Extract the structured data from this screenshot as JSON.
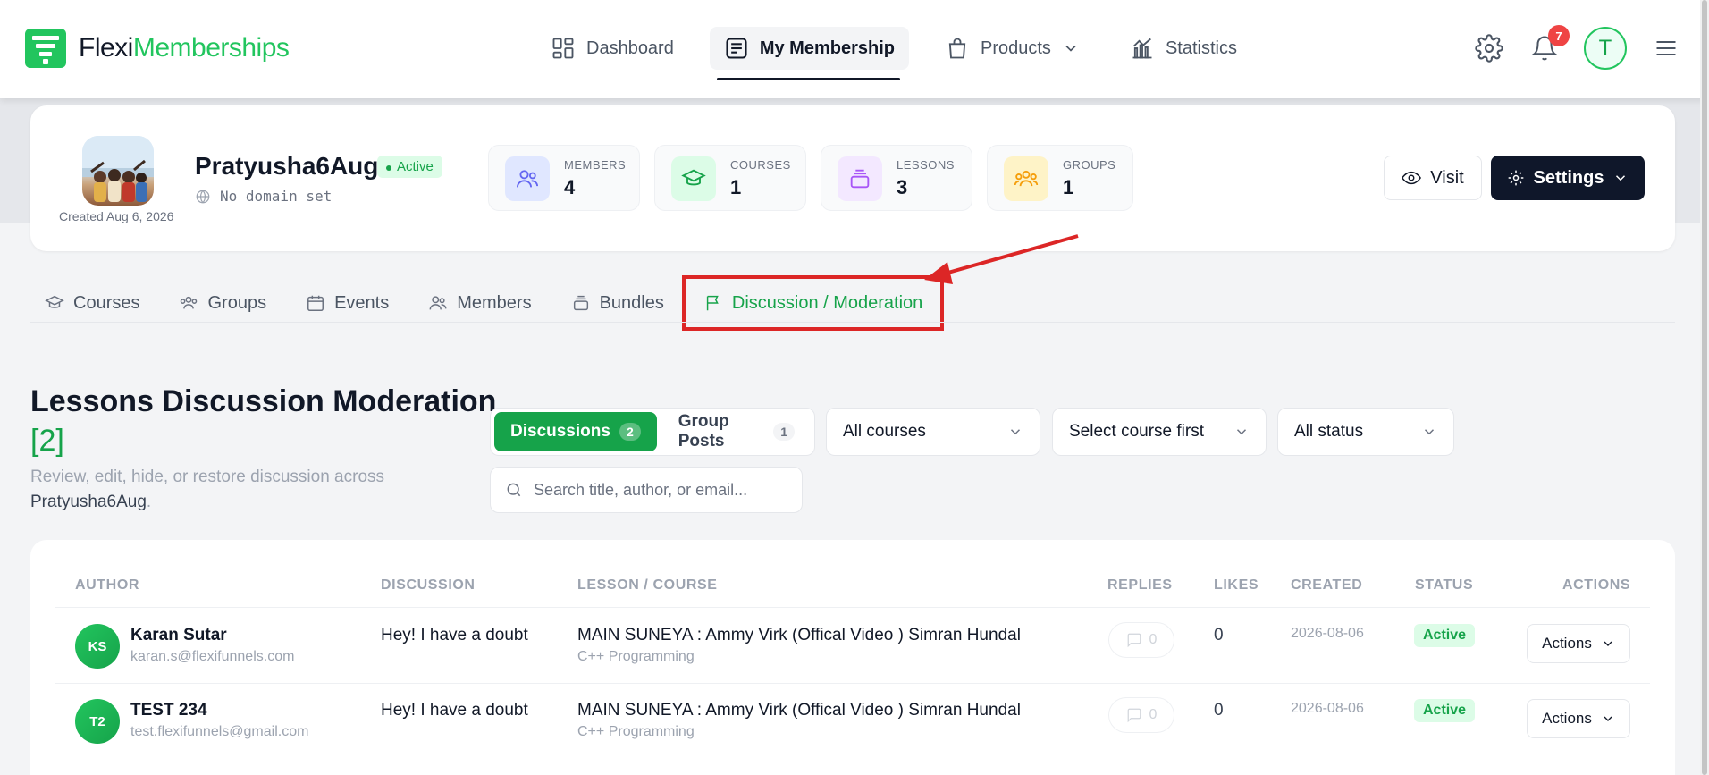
{
  "brand": {
    "part1": "Flexi",
    "part2": "Memberships"
  },
  "nav": {
    "items": [
      {
        "label": "Dashboard",
        "icon": "grid-icon"
      },
      {
        "label": "My Membership",
        "icon": "membership-icon",
        "active": true
      },
      {
        "label": "Products",
        "icon": "bag-icon",
        "has_dropdown": true
      },
      {
        "label": "Statistics",
        "icon": "chart-icon"
      }
    ],
    "notifications_count": "7",
    "user_initial": "T"
  },
  "profile": {
    "name": "Pratyusha6Aug",
    "status": "Active",
    "domain": "No domain set",
    "created": "Created Aug 6, 2026",
    "stats": [
      {
        "label": "MEMBERS",
        "value": "4"
      },
      {
        "label": "COURSES",
        "value": "1"
      },
      {
        "label": "LESSONS",
        "value": "3"
      },
      {
        "label": "GROUPS",
        "value": "1"
      }
    ],
    "visit_label": "Visit",
    "settings_label": "Settings"
  },
  "tabs": [
    {
      "label": "Courses"
    },
    {
      "label": "Groups"
    },
    {
      "label": "Events"
    },
    {
      "label": "Members"
    },
    {
      "label": "Bundles"
    },
    {
      "label": "Discussion / Moderation",
      "active": true
    }
  ],
  "section": {
    "title": "Lessons Discussion Moderation",
    "count": "[2]",
    "description_prefix": "Review, edit, hide, or restore discussion across",
    "description_space": "Pratyusha6Aug",
    "description_suffix": "."
  },
  "filters": {
    "seg": [
      {
        "label": "Discussions",
        "count": "2",
        "on": true
      },
      {
        "label": "Group Posts",
        "count": "1",
        "on": false
      }
    ],
    "courses_select": "All courses",
    "lesson_select": "Select course first",
    "status_select": "All status",
    "search_placeholder": "Search title, author, or email..."
  },
  "table": {
    "headers": [
      "AUTHOR",
      "DISCUSSION",
      "LESSON / COURSE",
      "REPLIES",
      "LIKES",
      "CREATED",
      "STATUS",
      "ACTIONS"
    ],
    "rows": [
      {
        "initials": "KS",
        "name": "Karan Sutar",
        "email": "karan.s@flexifunnels.com",
        "discussion": "Hey! I have a doubt",
        "lesson": "MAIN SUNEYA : Ammy Virk (Offical Video ) Simran Hundal",
        "course": "C++ Programming",
        "replies": "0",
        "likes": "0",
        "created": "2026-08-06",
        "status": "Active",
        "action": "Actions"
      },
      {
        "initials": "T2",
        "name": "TEST 234",
        "email": "test.flexifunnels@gmail.com",
        "discussion": "Hey! I have a doubt",
        "lesson": "MAIN SUNEYA : Ammy Virk (Offical Video ) Simran Hundal",
        "course": "C++ Programming",
        "replies": "0",
        "likes": "0",
        "created": "2026-08-06",
        "status": "Active",
        "action": "Actions"
      }
    ]
  },
  "colors": {
    "accent": "#16a34a",
    "highlight": "#dc2626",
    "dark": "#0f172a"
  }
}
